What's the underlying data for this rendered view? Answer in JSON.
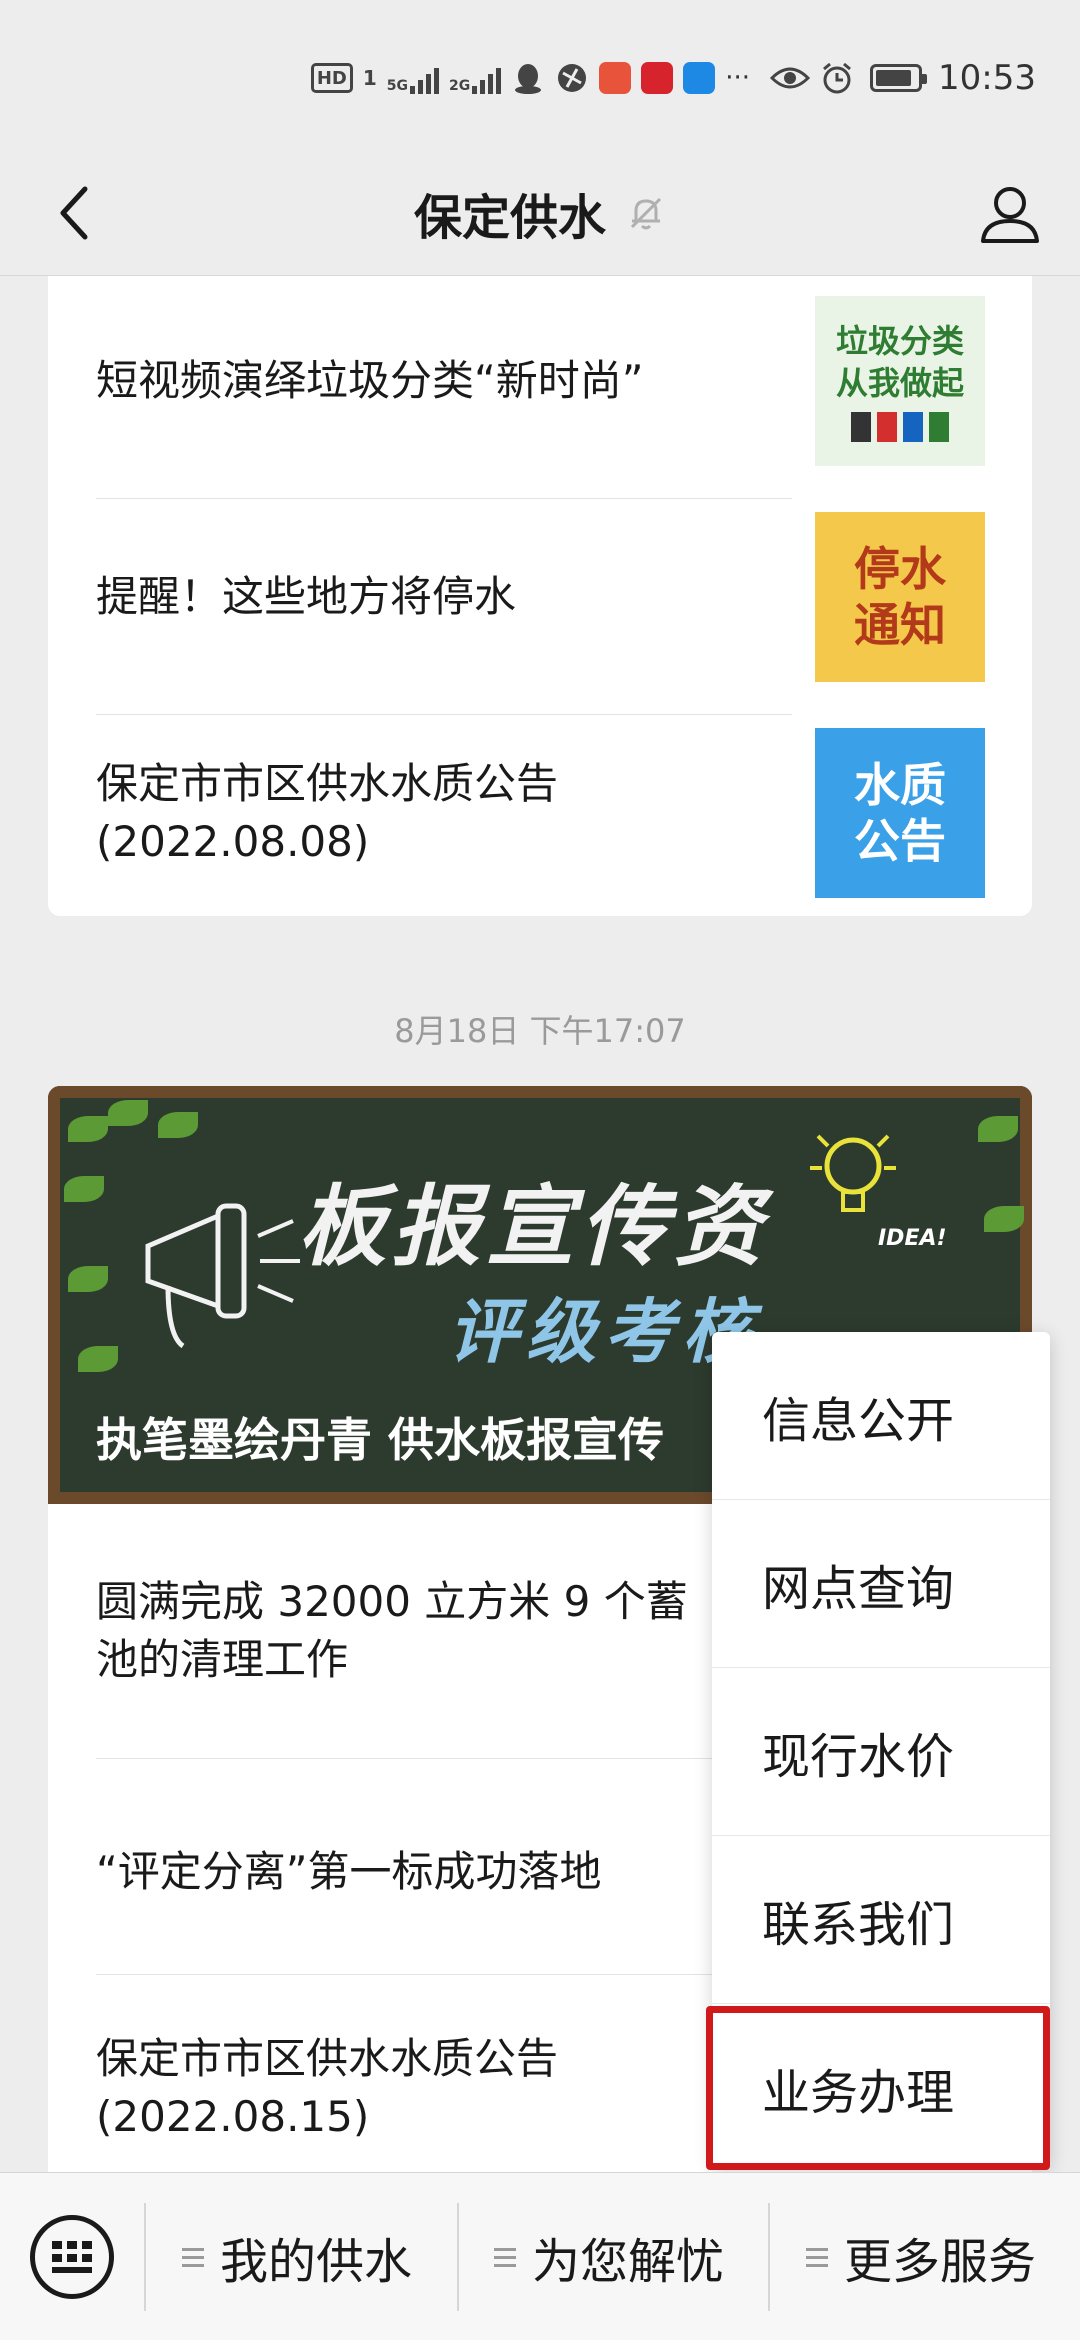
{
  "status_bar": {
    "hd_label": "HD",
    "sim_label": "1",
    "net1_label": "5G",
    "net2_label": "2G",
    "more_label": "···",
    "time": "10:53",
    "icons": [
      "hd-icon",
      "signal-icon",
      "qq-icon",
      "browser-icon",
      "app-icon",
      "app-icon",
      "app-icon",
      "eye-icon",
      "alarm-icon",
      "battery-icon"
    ]
  },
  "header": {
    "title": "保定供水",
    "icons": [
      "back-icon",
      "mute-bell-icon",
      "user-icon"
    ]
  },
  "articles_group1": [
    {
      "title": "短视频演绎垃圾分类“新时尚”",
      "thumb": [
        "垃圾分类",
        "从我做起"
      ]
    },
    {
      "title": "提醒！这些地方将停水",
      "thumb": [
        "停水",
        "通知"
      ]
    },
    {
      "title": "保定市市区供水水质公告",
      "title2": "(2022.08.08)",
      "thumb": [
        "水质",
        "公告"
      ]
    }
  ],
  "timestamp": "8月18日 下午17:07",
  "banner": {
    "title_art1": "板报宣传资",
    "title_art2": "评级考核",
    "idea": "IDEA!",
    "caption": "执笔墨绘丹青 供水板报宣传"
  },
  "articles_group2": [
    {
      "title": "圆满完成 32000 立方米  9 个蓄",
      "title2": "池的清理工作"
    },
    {
      "title": "“评定分离”第一标成功落地"
    },
    {
      "title": "保定市市区供水水质公告",
      "title2": "(2022.08.15)"
    }
  ],
  "menu": {
    "items": [
      "信息公开",
      "网点查询",
      "现行水价",
      "联系我们",
      "业务办理"
    ],
    "highlighted_index": 4,
    "highlight_color": "#d1191c"
  },
  "bottom_bar": {
    "tabs": [
      "我的供水",
      "为您解忧",
      "更多服务"
    ],
    "icons": [
      "keyboard-icon",
      "menu-lines-icon"
    ]
  }
}
